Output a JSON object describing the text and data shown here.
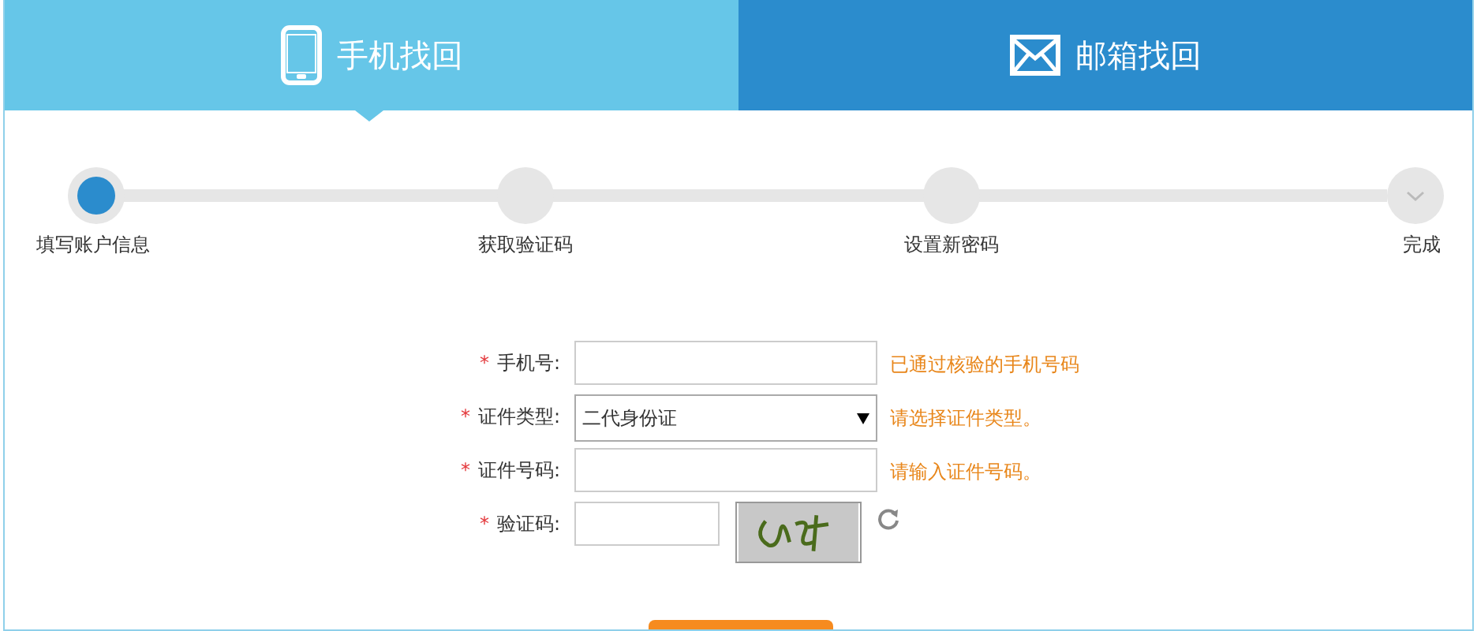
{
  "tabs": [
    {
      "label": "手机找回",
      "kind": "phone",
      "selected": true
    },
    {
      "label": "邮箱找回",
      "kind": "mail",
      "selected": false
    }
  ],
  "steps": [
    {
      "label": "填写账户信息",
      "active": true,
      "kind": "plain"
    },
    {
      "label": "获取验证码",
      "active": false,
      "kind": "plain"
    },
    {
      "label": "设置新密码",
      "active": false,
      "kind": "plain"
    },
    {
      "label": "完成",
      "active": false,
      "kind": "check"
    }
  ],
  "form": [
    {
      "kind": "text",
      "mark": "*",
      "label": "手机号:",
      "hint": "已通过核验的手机号码"
    },
    {
      "kind": "select",
      "mark": "*",
      "label": "证件类型:",
      "value": "二代身份证",
      "hint": "请选择证件类型。"
    },
    {
      "kind": "text",
      "mark": "*",
      "label": "证件号码:",
      "hint": "请输入证件号码。"
    },
    {
      "kind": "captcha",
      "mark": "*",
      "label": "验证码:"
    }
  ]
}
